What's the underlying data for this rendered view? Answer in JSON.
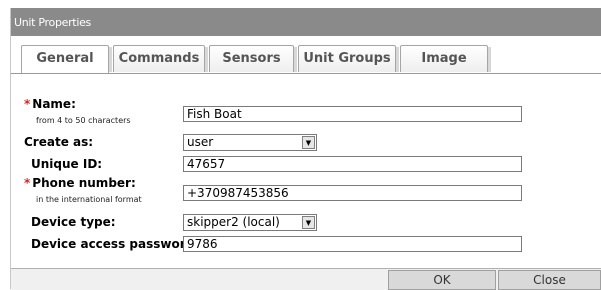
{
  "window": {
    "title": "Unit Properties"
  },
  "tabs": [
    {
      "label": "General"
    },
    {
      "label": "Commands"
    },
    {
      "label": "Sensors"
    },
    {
      "label": "Unit Groups"
    },
    {
      "label": "Image"
    }
  ],
  "form": {
    "name": {
      "required_mark": "*",
      "label": "Name:",
      "hint": "from 4 to 50 characters",
      "value": "Fish Boat"
    },
    "create_as": {
      "label": "Create as:",
      "value": "user"
    },
    "unique_id": {
      "label": "Unique ID:",
      "value": "47657"
    },
    "phone": {
      "required_mark": "*",
      "label": "Phone number:",
      "hint": "in the international format",
      "value": "+370987453856"
    },
    "device_type": {
      "label": "Device type:",
      "value": "skipper2 (local)"
    },
    "password": {
      "label": "Device access password:",
      "value": "9786"
    }
  },
  "footer": {
    "ok_label": "OK",
    "close_label": "Close"
  },
  "icons": {
    "dropdown_arrow": "▼"
  }
}
